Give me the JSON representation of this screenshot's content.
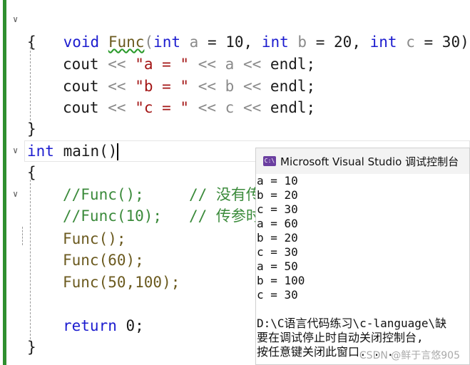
{
  "editor": {
    "lines": [
      {
        "kind": "sig1"
      },
      {
        "kind": "text",
        "text": "{"
      },
      {
        "kind": "blank"
      },
      {
        "kind": "cout",
        "var": "a",
        "label": "\"a = \""
      },
      {
        "kind": "cout",
        "var": "b",
        "label": "\"b = \""
      },
      {
        "kind": "cout",
        "var": "c",
        "label": "\"c = \""
      },
      {
        "kind": "text",
        "text": "}"
      }
    ],
    "func_sig": {
      "ret": "void",
      "name": "Func",
      "type": "int",
      "a": "a",
      "b": "b",
      "c": "c",
      "a_def": "10",
      "b_def": "20",
      "c_def": "30"
    },
    "cout_word": "cout",
    "op": "<<",
    "endl": "endl;",
    "main_sig": {
      "ret": "int",
      "name": "main()"
    },
    "comment1": "//Func();     // 没有传",
    "comment2": "//Func(10);   // 传参时",
    "call1": "Func();",
    "call2": "Func(60);",
    "call3": "Func(50,100);",
    "return_kw": "return",
    "return_val": "0;",
    "open_brace": "{",
    "close_brace": "}"
  },
  "console": {
    "title": "Microsoft Visual Studio 调试控制台",
    "icon": "C:\\",
    "output": [
      "a = 10",
      "b = 20",
      "c = 30",
      "a = 60",
      "b = 20",
      "c = 30",
      "a = 50",
      "b = 100",
      "c = 30",
      "",
      "D:\\C语言代码练习\\c-language\\缺",
      "要在调试停止时自动关闭控制台,",
      "按任意键关闭此窗口. . ."
    ],
    "watermark": "CSDN @鲜于言悠905"
  }
}
